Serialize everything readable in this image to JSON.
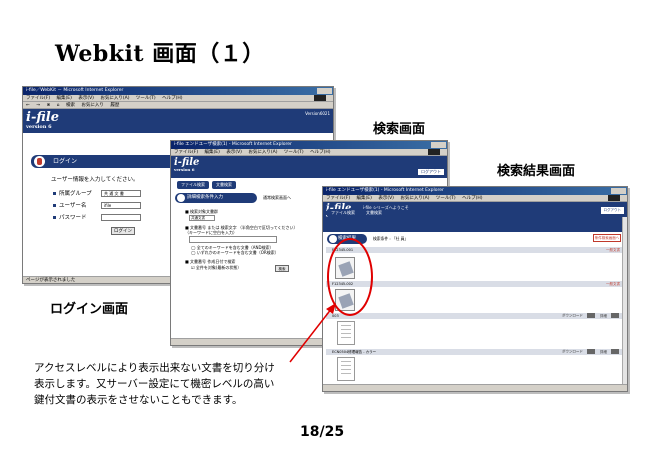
{
  "slide": {
    "title": "Webkit 画面（１）",
    "page_number": "18/25"
  },
  "captions": {
    "login": "ログイン画面",
    "search": "検索画面",
    "results": "検索結果画面"
  },
  "note_lines": [
    "アクセスレベルにより表示出来ない文書を切り分け",
    "表示します。又サーバー設定にて機密レベルの高い",
    "鍵付文書の表示をさせないこともできます。"
  ],
  "login_window": {
    "title": "i-file／WebKit － Microsoft Internet Explorer",
    "menu": [
      "ファイル(F)",
      "編集(E)",
      "表示(V)",
      "お気に入り(A)",
      "ツール(T)",
      "ヘルプ(H)"
    ],
    "toolbar": [
      "←",
      "→",
      "⊗",
      "⌂",
      "検索",
      "お気に入り",
      "履歴"
    ],
    "brand": "i-file",
    "brand_version": "version 6",
    "version_label": "Version6021",
    "section_title": "ログイン",
    "message": "ユーザー情報を入力してください。",
    "fields": [
      {
        "label": "所属グループ",
        "value": "共 通 文 書"
      },
      {
        "label": "ユーザー名",
        "value": "ifile"
      },
      {
        "label": "パスワード",
        "value": ""
      }
    ],
    "login_button": "ログイン",
    "status": "ページが表示されました"
  },
  "search_window": {
    "title": "i-file エンドユーザ検索(1) - Microsoft Internet Explorer",
    "menu": [
      "ファイル(F)",
      "編集(E)",
      "表示(V)",
      "お気に入り(A)",
      "ツール(T)",
      "ヘルプ(H)"
    ],
    "brand": "i-file",
    "brand_version": "version 6",
    "tabs": [
      "ファイル検索",
      "文書検索"
    ],
    "logout": "ログアウト",
    "section_title": "詳細検索条件入力",
    "link": "通常検索画面へ",
    "lines": [
      "■ 検索対象文書群",
      "■ 文書番号 または 検索文字 （半角空白で区切ってください）",
      "（キーワードに空白を入力）",
      "◯ 全てのキーワードを含む文書（AND検索）",
      "◯ いずれかのキーワードを含む文書（OR検索）",
      "■ 文書番号 作成日付で検索",
      "☑ 全件を対象(最新の状態）"
    ],
    "select_value": "共通文書",
    "search_button": "検索"
  },
  "results_window": {
    "title": "i-file エンドユーザ検索(1) - Microsoft Internet Explorer",
    "menu": [
      "ファイル(F)",
      "編集(E)",
      "表示(V)",
      "お気に入り(A)",
      "ツール(T)",
      "ヘルプ(H)"
    ],
    "brand": "i-file",
    "brand_version": "version 6",
    "subtitle": "i-file シリーズへようこそ",
    "tabs": [
      "ファイル検索",
      "文書検索"
    ],
    "logout": "ログアウト",
    "section_title": "検索結果",
    "condition": "検索条件 : 「社 員」",
    "back_button": "条件検索画面へ",
    "rows": [
      {
        "label": "F12345-001",
        "rank": "一般文書"
      },
      {
        "label": "F12345-002",
        "rank": "一般文書"
      },
      {
        "label": "003",
        "rank": ""
      },
      {
        "label": "ECN0504修理報告 - カラー",
        "rank": ""
      }
    ],
    "icon_labels": [
      "ダウンロード",
      "詳細"
    ]
  }
}
